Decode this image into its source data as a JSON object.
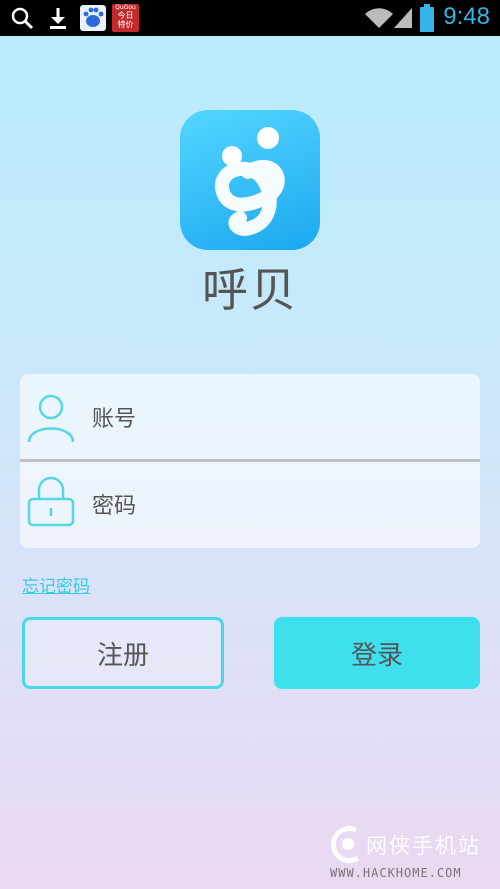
{
  "status_bar": {
    "time": "9:48",
    "icons": [
      "search-icon",
      "download-icon",
      "baidu-icon",
      "qugou-icon",
      "wifi-icon",
      "signal-icon",
      "battery-icon"
    ],
    "qugou_label_top": "QuGou",
    "qugou_label_lines": [
      "今日",
      "特价"
    ]
  },
  "app": {
    "title": "呼贝"
  },
  "form": {
    "account_placeholder": "账号",
    "password_placeholder": "密码"
  },
  "links": {
    "forgot_password": "忘记密码"
  },
  "buttons": {
    "register": "注册",
    "login": "登录"
  },
  "watermark": {
    "text": "网侠手机站",
    "url": "WWW.HACKHOME.COM"
  },
  "colors": {
    "accent": "#3ee0ee",
    "status_accent": "#33b5e5",
    "logo": "#1ca8f0"
  }
}
